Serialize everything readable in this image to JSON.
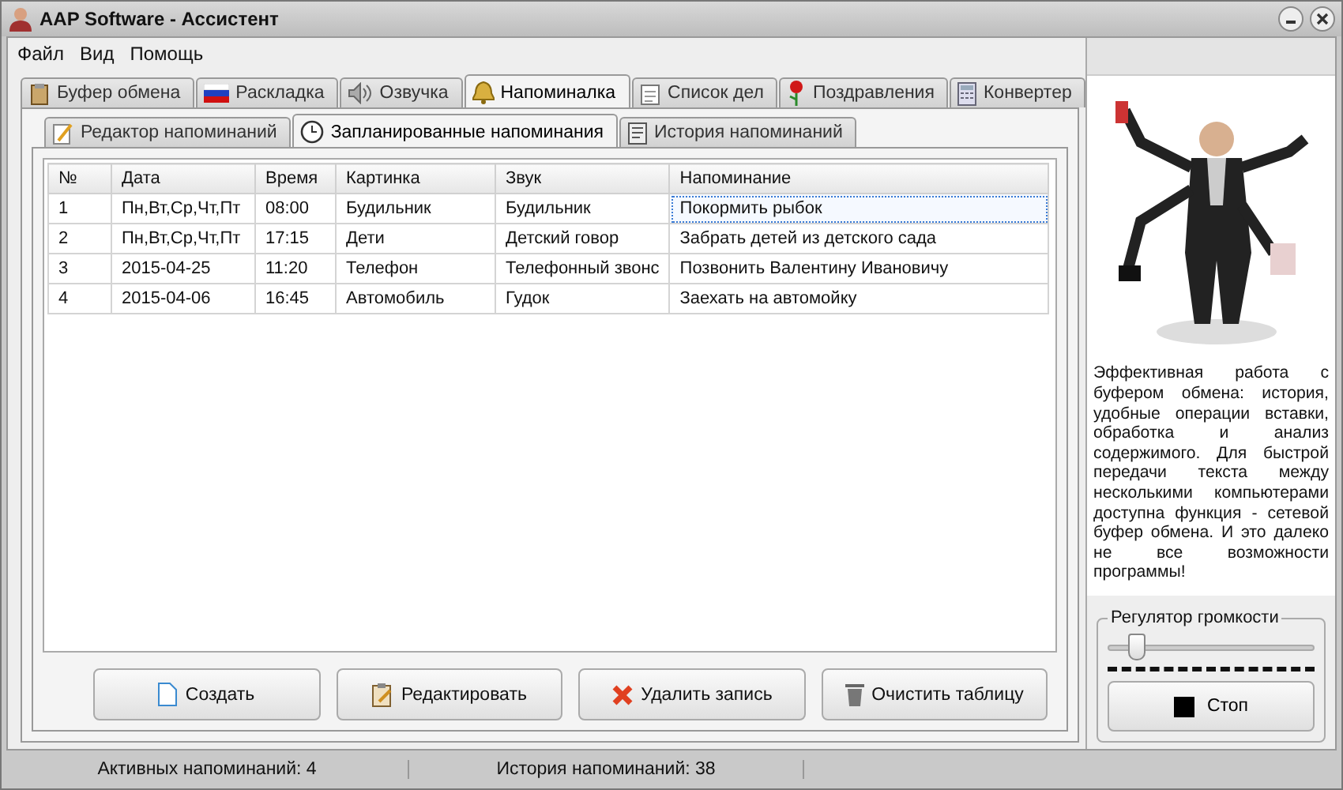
{
  "window": {
    "title": "AAP Software - Ассистент"
  },
  "menu": [
    "Файл",
    "Вид",
    "Помощь"
  ],
  "tabs": [
    {
      "label": "Буфер обмена",
      "selected": false
    },
    {
      "label": "Раскладка",
      "selected": false
    },
    {
      "label": "Озвучка",
      "selected": false
    },
    {
      "label": "Напоминалка",
      "selected": true
    },
    {
      "label": "Список дел",
      "selected": false
    },
    {
      "label": "Поздравления",
      "selected": false
    },
    {
      "label": "Конвертер",
      "selected": false
    }
  ],
  "subtabs": [
    {
      "label": "Редактор напоминаний",
      "selected": false
    },
    {
      "label": "Запланированные напоминания",
      "selected": true
    },
    {
      "label": "История напоминаний",
      "selected": false
    }
  ],
  "table": {
    "columns": [
      "№",
      "Дата",
      "Время",
      "Картинка",
      "Звук",
      "Напоминание"
    ],
    "rows": [
      {
        "cells": [
          "1",
          "Пн,Вт,Ср,Чт,Пт",
          "08:00",
          "Будильник",
          "Будильник",
          "Покормить рыбок"
        ],
        "focused": true
      },
      {
        "cells": [
          "2",
          "Пн,Вт,Ср,Чт,Пт",
          "17:15",
          "Дети",
          "Детский говор",
          "Забрать детей из детского сада"
        ],
        "focused": false
      },
      {
        "cells": [
          "3",
          "2015-04-25",
          "11:20",
          "Телефон",
          "Телефонный звонс",
          "Позвонить Валентину Ивановичу"
        ],
        "focused": false
      },
      {
        "cells": [
          "4",
          "2015-04-06",
          "16:45",
          "Автомобиль",
          "Гудок",
          "Заехать на автомойку"
        ],
        "focused": false
      }
    ]
  },
  "buttons": [
    "Создать",
    "Редактировать",
    "Удалить запись",
    "Очистить таблицу"
  ],
  "side": {
    "description": "Эффективная работа с буфером обмена: история, удобные операции вставки, обработка и анализ содержимого. Для быстрой передачи текста между несколькими компьютерами доступна функция - сетевой буфер обмена. И это далеко не все возможности программы!",
    "volume": {
      "title": "Регулятор громкости",
      "level": 0.1
    },
    "stop_button": "Стоп"
  },
  "status_bar": [
    "Активных напоминаний: 4",
    "История напоминаний: 38"
  ]
}
